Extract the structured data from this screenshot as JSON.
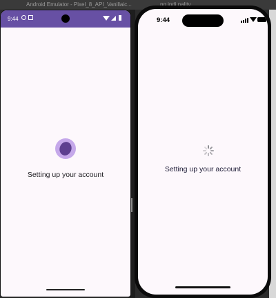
{
  "emulator": {
    "title": "Android Emulator - Pixel_8_API_Vanillaic...",
    "title_tail": "ng indi                    nality"
  },
  "android": {
    "status_time": "9:44",
    "status_icons": [
      "settings-icon",
      "notification-icon",
      "wifi-icon",
      "signal-icon",
      "battery-icon"
    ],
    "accent_color": "#6750a4",
    "loading_label": "Setting up your account"
  },
  "ios": {
    "status_time": "9:44",
    "status_icons": [
      "signal-icon",
      "wifi-icon",
      "battery-icon"
    ],
    "loading_label": "Setting up your account"
  }
}
